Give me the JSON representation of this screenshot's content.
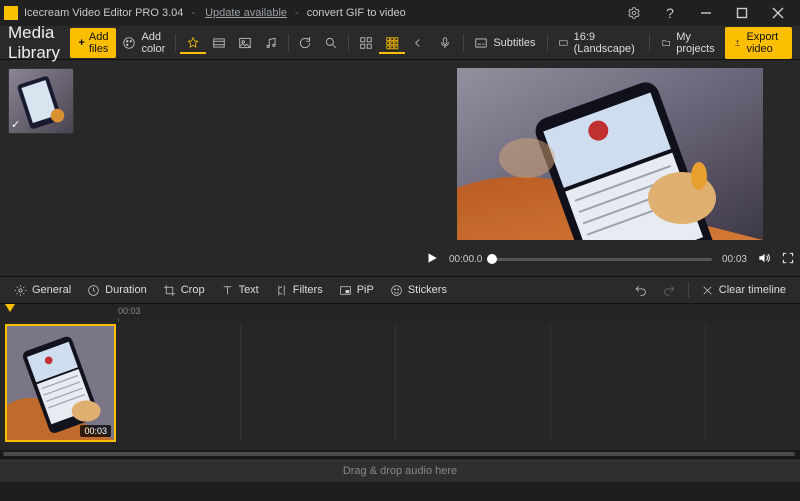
{
  "titlebar": {
    "app_name": "Icecream Video Editor PRO 3.04",
    "update_link": "Update available",
    "task": "convert GIF to video"
  },
  "toolbar": {
    "media_library": "Media Library",
    "add_files": "Add files",
    "add_color": "Add color"
  },
  "right_toolbar": {
    "subtitles": "Subtitles",
    "aspect": "16:9 (Landscape)",
    "my_projects": "My projects",
    "export": "Export video"
  },
  "preview": {
    "current": "00:00.0",
    "total": "00:03"
  },
  "edit_tools": {
    "general": "General",
    "duration": "Duration",
    "crop": "Crop",
    "text": "Text",
    "filters": "Filters",
    "pip": "PiP",
    "stickers": "Stickers",
    "clear": "Clear timeline"
  },
  "timeline": {
    "marker1": "00:03",
    "clip_duration": "00:03"
  },
  "audio_drop": "Drag & drop audio here"
}
